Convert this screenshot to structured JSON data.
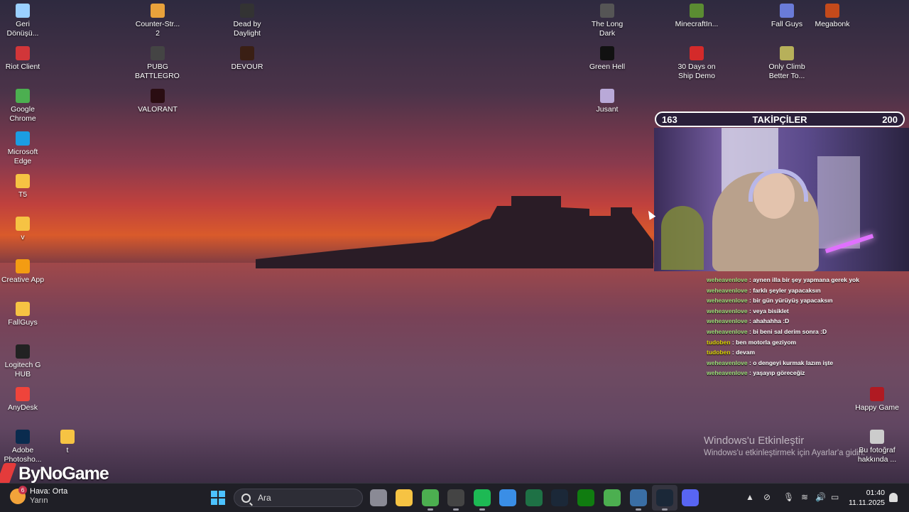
{
  "desktop": {
    "icons_left": [
      {
        "label": "Geri Dönüşü...",
        "icon": "recycle-bin-icon",
        "color": "#9ad0ff"
      },
      {
        "label": "Riot Client",
        "icon": "riot-client-icon",
        "color": "#d13639"
      },
      {
        "label": "Google Chrome",
        "icon": "chrome-icon",
        "color": "#4caf50"
      },
      {
        "label": "Microsoft Edge",
        "icon": "edge-icon",
        "color": "#1b9de2"
      },
      {
        "label": "T5",
        "icon": "folder-icon",
        "color": "#f6c343"
      },
      {
        "label": "v",
        "icon": "folder-icon",
        "color": "#f6c343"
      },
      {
        "label": "Creative App",
        "icon": "creative-app-icon",
        "color": "#f39c12"
      },
      {
        "label": "FallGuys",
        "icon": "folder-icon",
        "color": "#f6c343"
      },
      {
        "label": "Logitech G HUB",
        "icon": "logitech-icon",
        "color": "#222222"
      },
      {
        "label": "AnyDesk",
        "icon": "anydesk-icon",
        "color": "#ef443b"
      },
      {
        "label": "Adobe Photosho...",
        "icon": "photoshop-icon",
        "color": "#0a2b4e"
      }
    ],
    "icon_t": {
      "label": "t",
      "icon": "folder-icon",
      "color": "#f6c343"
    },
    "icons_col2": [
      {
        "label": "Counter-Str... 2",
        "icon": "cs2-icon",
        "color": "#e9a23b"
      },
      {
        "label": "PUBG BATTLEGRO...",
        "icon": "pubg-icon",
        "color": "#444444"
      },
      {
        "label": "VALORANT",
        "icon": "valorant-icon",
        "color": "#2a0d12"
      }
    ],
    "icons_col3": [
      {
        "label": "Dead by Daylight",
        "icon": "dbd-icon",
        "color": "#333333"
      },
      {
        "label": "DEVOUR",
        "icon": "devour-icon",
        "color": "#3a1f14"
      }
    ],
    "icons_col4": [
      {
        "label": "The Long Dark",
        "icon": "long-dark-icon",
        "color": "#555555"
      },
      {
        "label": "Green Hell",
        "icon": "green-hell-icon",
        "color": "#111111"
      },
      {
        "label": "Jusant",
        "icon": "jusant-icon",
        "color": "#b9a9d8"
      }
    ],
    "icons_col5": [
      {
        "label": "MinecraftIn...",
        "icon": "minecraft-icon",
        "color": "#5b8c32"
      },
      {
        "label": "30 Days on Ship Demo",
        "icon": "30days-icon",
        "color": "#d42a2a"
      }
    ],
    "icons_col6": [
      {
        "label": "Fall Guys",
        "icon": "fall-guys-icon",
        "color": "#6a7bd8"
      },
      {
        "label": "Only Climb Better To...",
        "icon": "only-climb-icon",
        "color": "#b7b05a"
      }
    ],
    "icons_col7": [
      {
        "label": "Megabonk",
        "icon": "megabonk-icon",
        "color": "#c44a1b"
      }
    ],
    "happy_game": {
      "label": "Happy Game",
      "icon": "happy-game-icon",
      "color": "#b01a22"
    },
    "photo_about": {
      "label": "Bu fotoğraf hakkında ...",
      "icon": "camera-info-icon",
      "color": "#cccccc"
    }
  },
  "overlay": {
    "followers": {
      "current": "163",
      "title": "TAKİPÇİLER",
      "goal": "200"
    },
    "chat": [
      {
        "user": "weheavenlove",
        "text": "aynen illa bir şey yapmana gerek yok",
        "color": "green"
      },
      {
        "user": "weheavenlove",
        "text": "farklı şeyler yapacaksın",
        "color": "green"
      },
      {
        "user": "weheavenlove",
        "text": "bir gün yürüyüş yapacaksın",
        "color": "green"
      },
      {
        "user": "weheavenlove",
        "text": "veya bisiklet",
        "color": "green"
      },
      {
        "user": "weheavenlove",
        "text": "ahahahha :D",
        "color": "green"
      },
      {
        "user": "weheavenlove",
        "text": "bi beni sal derim sonra :D",
        "color": "green"
      },
      {
        "user": "tudoben",
        "text": "ben motorla geziyom",
        "color": "yellow"
      },
      {
        "user": "tudoben",
        "text": "devam",
        "color": "yellow"
      },
      {
        "user": "weheavenlove",
        "text": "o dengeyi kurmak lazım işte",
        "color": "green"
      },
      {
        "user": "weheavenlove",
        "text": "yaşayıp göreceğiz",
        "color": "green"
      }
    ],
    "brand": "ByNoGame"
  },
  "activation": {
    "title": "Windows'u Etkinleştir",
    "subtitle": "Windows'u etkinleştirmek için Ayarlar'a gidin."
  },
  "taskbar": {
    "weather": {
      "badge": "6",
      "title": "Hava: Orta",
      "subtitle": "Yarın"
    },
    "search_placeholder": "Ara",
    "apps": [
      {
        "name": "task-view",
        "icon": "task-view-icon",
        "color": "#8a8a95"
      },
      {
        "name": "file-explorer",
        "icon": "folder-icon",
        "color": "#f6c343"
      },
      {
        "name": "chrome",
        "icon": "chrome-icon",
        "color": "#4caf50"
      },
      {
        "name": "obs",
        "icon": "obs-icon",
        "color": "#444444"
      },
      {
        "name": "spotify",
        "icon": "spotify-icon",
        "color": "#1db954"
      },
      {
        "name": "store",
        "icon": "store-icon",
        "color": "#3a8ee6"
      },
      {
        "name": "excel",
        "icon": "excel-icon",
        "color": "#1e7145"
      },
      {
        "name": "steam",
        "icon": "steam-icon",
        "color": "#1b2838"
      },
      {
        "name": "xbox",
        "icon": "xbox-icon",
        "color": "#107c10"
      },
      {
        "name": "chrome-profile",
        "icon": "chrome-icon",
        "color": "#4caf50"
      },
      {
        "name": "game-app",
        "icon": "game-app-icon",
        "color": "#3a6ea5"
      },
      {
        "name": "steam-active",
        "icon": "steam-icon",
        "color": "#1b2838"
      },
      {
        "name": "discord",
        "icon": "discord-icon",
        "color": "#5865f2"
      }
    ],
    "clock": {
      "time": "01:40",
      "date": "11.11.2025"
    }
  }
}
